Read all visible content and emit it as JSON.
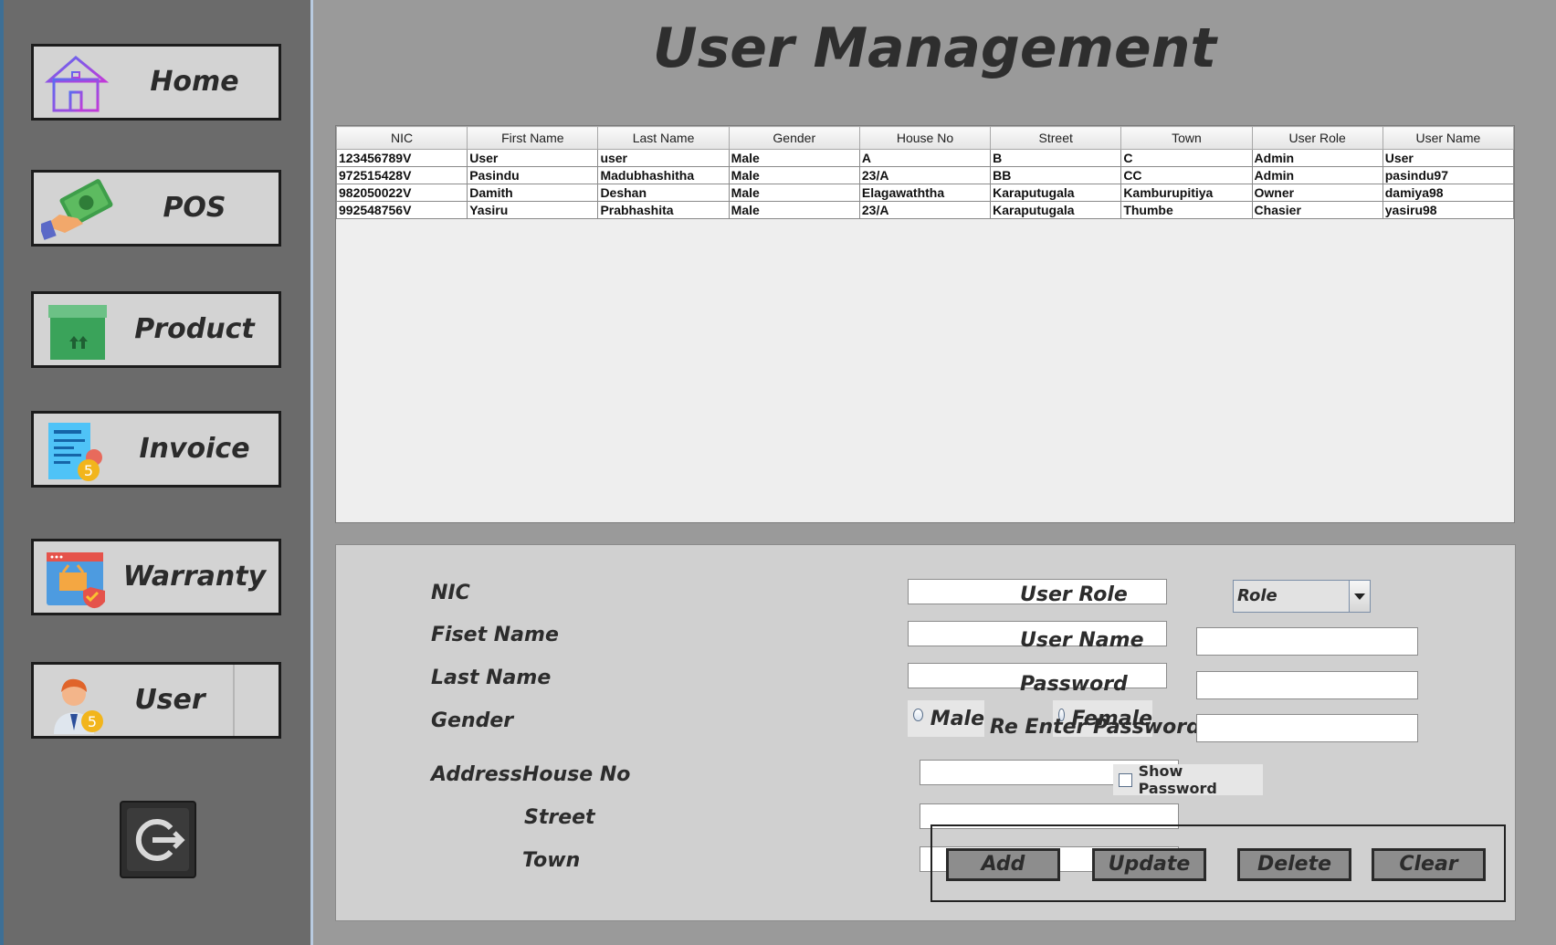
{
  "nav": {
    "home_label": "Home",
    "pos_label": "POS",
    "product_label": "Product",
    "invoice_label": "Invoice",
    "warranty_label": "Warranty",
    "user_label": "User"
  },
  "header": {
    "title": "User Management"
  },
  "table": {
    "columns": [
      "NIC",
      "First Name",
      "Last Name",
      "Gender",
      "House No",
      "Street",
      "Town",
      "User Role",
      "User Name"
    ],
    "rows": [
      [
        "123456789V",
        "User",
        "user",
        "Male",
        "A",
        "B",
        "C",
        "Admin",
        "User"
      ],
      [
        "972515428V",
        "Pasindu",
        "Madubhashitha",
        "Male",
        "23/A",
        "BB",
        "CC",
        "Admin",
        "pasindu97"
      ],
      [
        "982050022V",
        "Damith",
        "Deshan",
        "Male",
        "Elagawaththa",
        "Karaputugala",
        "Kamburupitiya",
        "Owner",
        "damiya98"
      ],
      [
        "992548756V",
        "Yasiru",
        "Prabhashita",
        "Male",
        "23/A",
        "Karaputugala",
        "Thumbe",
        "Chasier",
        "yasiru98"
      ]
    ]
  },
  "form": {
    "nic_label": "NIC",
    "first_name_label": "Fiset Name",
    "last_name_label": "Last Name",
    "gender_label": "Gender",
    "male_label": "Male",
    "female_label": "Female",
    "address_label": "Address",
    "house_no_label": "House No",
    "street_label": "Street",
    "town_label": "Town",
    "user_role_label": "User Role",
    "role_selected": "Role",
    "user_name_label": "User Name",
    "password_label": "Password",
    "reenter_password_label": "Re Enter Password",
    "show_password_label": "Show Password",
    "nic_value": "",
    "first_name_value": "",
    "last_name_value": "",
    "house_no_value": "",
    "street_value": "",
    "town_value": "",
    "user_name_value": "",
    "password_value": "",
    "reenter_password_value": ""
  },
  "actions": {
    "add_label": "Add",
    "update_label": "Update",
    "delete_label": "Delete",
    "clear_label": "Clear"
  },
  "icons": {
    "home": "house-icon",
    "pos": "money-hand-icon",
    "product": "box-icon",
    "invoice": "invoice-icon",
    "warranty": "warranty-shield-icon",
    "user": "user-avatar-icon",
    "logout": "logout-icon"
  }
}
